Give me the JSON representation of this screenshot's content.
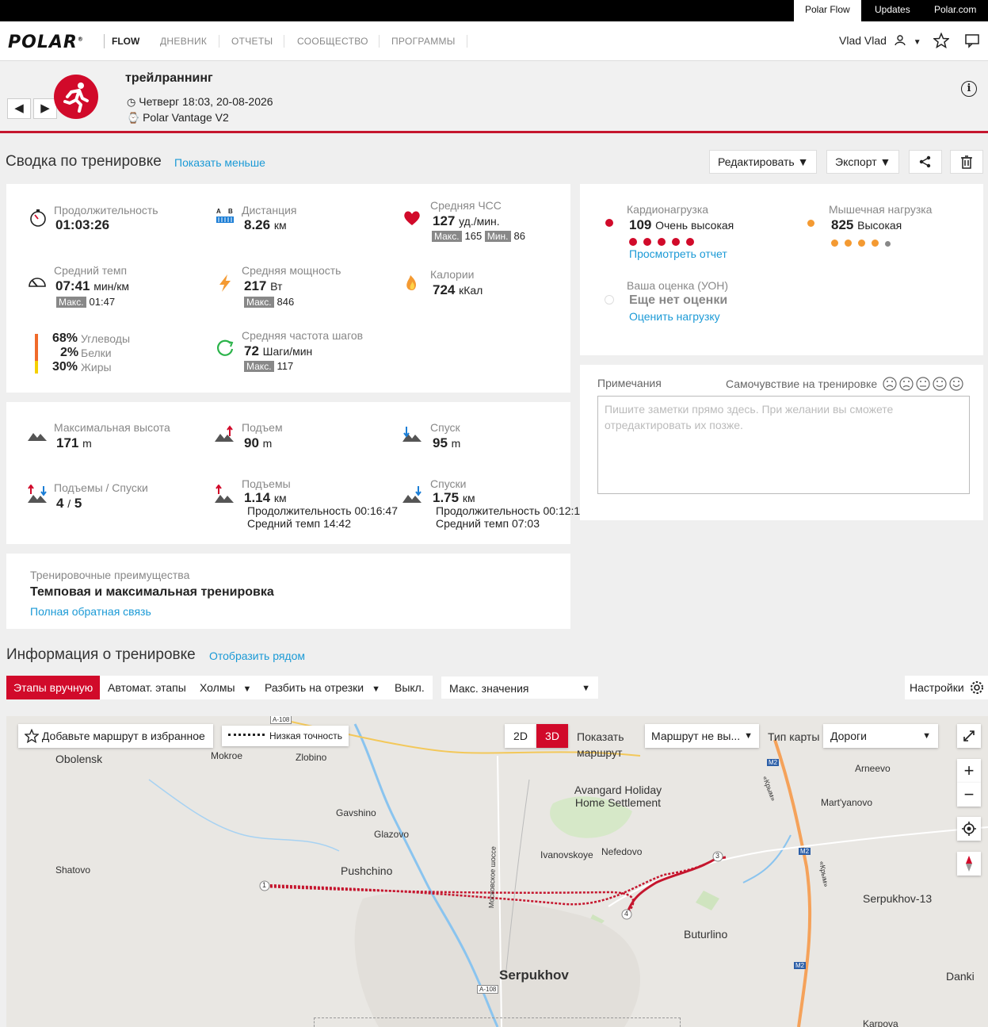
{
  "topbar": {
    "links": [
      "Polar Flow",
      "Updates",
      "Polar.com"
    ]
  },
  "nav": {
    "logo": "POLAR",
    "logo_mark": "®",
    "flow": "FLOW",
    "items": [
      "ДНЕВНИК",
      "ОТЧЕТЫ",
      "СООБЩЕСТВО",
      "ПРОГРАММЫ"
    ],
    "user": "Vlad Vlad"
  },
  "header": {
    "sport": "трейлраннинг",
    "date": "Четверг 18:03, 20-08-2026",
    "device": "Polar Vantage V2",
    "prev": "◀",
    "next": "▶",
    "info": "i"
  },
  "summary": {
    "title": "Сводка по тренировке",
    "toggle": "Показать меньше",
    "buttons": {
      "edit": "Редактировать ▼",
      "export": "Экспорт ▼"
    }
  },
  "metrics": {
    "duration": {
      "label": "Продолжительность",
      "value": "01:03:26"
    },
    "distance": {
      "label": "Дистанция",
      "value": "8.26",
      "unit": "км"
    },
    "hr": {
      "label": "Средняя ЧСС",
      "value": "127",
      "unit": "уд./мин.",
      "max_label": "Макс.",
      "max": "165",
      "min_label": "Мин.",
      "min": "86"
    },
    "pace": {
      "label": "Средний темп",
      "value": "07:41",
      "unit": "мин/км",
      "max_label": "Макс.",
      "max": "01:47"
    },
    "power": {
      "label": "Средняя мощность",
      "value": "217",
      "unit": "Вт",
      "max_label": "Макс.",
      "max": "846"
    },
    "calories": {
      "label": "Калории",
      "value": "724",
      "unit": "кКал"
    },
    "fuel": [
      {
        "pct": "68%",
        "label": "Углеводы"
      },
      {
        "pct": "2%",
        "label": "Белки"
      },
      {
        "pct": "30%",
        "label": "Жиры"
      }
    ],
    "cadence": {
      "label": "Средняя частота шагов",
      "value": "72",
      "unit": "Шаги/мин",
      "max_label": "Макс.",
      "max": "117"
    }
  },
  "elevation": {
    "max_alt": {
      "label": "Максимальная высота",
      "value": "171",
      "unit": "m"
    },
    "ascent": {
      "label": "Подъем",
      "value": "90",
      "unit": "m"
    },
    "descent": {
      "label": "Спуск",
      "value": "95",
      "unit": "m"
    },
    "climbs": {
      "label": "Подъемы / Спуски",
      "value": "4",
      "sep": "/",
      "value2": "5"
    },
    "uphills": {
      "label": "Подъемы",
      "value": "1.14",
      "unit": "км",
      "duration": "Продолжительность 00:16:47",
      "pace": "Средний темп 14:42"
    },
    "downhills": {
      "label": "Спуски",
      "value": "1.75",
      "unit": "км",
      "duration": "Продолжительность 00:12:1",
      "pace": "Средний темп 07:03"
    }
  },
  "benefit": {
    "label": "Тренировочные преимущества",
    "value": "Темповая и максимальная тренировка",
    "link": "Полная обратная связь"
  },
  "load": {
    "cardio": {
      "label": "Кардионагрузка",
      "value": "109",
      "text": "Очень высокая",
      "dots_filled": 5,
      "dots_total": 5,
      "link": "Просмотреть отчет"
    },
    "muscle": {
      "label": "Мышечная нагрузка",
      "value": "825",
      "text": "Высокая",
      "dots_filled": 4,
      "dots_total": 5
    },
    "rpe": {
      "label": "Ваша оценка (УОН)",
      "value": "Еще нет оценки",
      "link": "Оценить нагрузку"
    }
  },
  "notes": {
    "label": "Примечания",
    "feeling_label": "Самочувствие на тренировке",
    "placeholder": "Пишите заметки прямо здесь. При желании вы сможете отредактировать их позже."
  },
  "info_section": {
    "title": "Информация о тренировке",
    "toggle": "Отобразить рядом",
    "laps": {
      "manual": "Этапы вручную",
      "auto": "Автомат. этапы",
      "hills": "Холмы",
      "split": "Разбить на отрезки",
      "off": "Выкл."
    },
    "select": "Макс. значения",
    "settings": "Настройки"
  },
  "map": {
    "favorite": "Добавьте маршрут в избранное",
    "accuracy": "Низкая точность",
    "mode_2d": "2D",
    "mode_3d": "3D",
    "show_route": "Показать маршрут",
    "route_select": "Маршрут не вы...",
    "map_type_label": "Тип карты",
    "map_type": "Дороги",
    "zoom_in": "+",
    "zoom_out": "−",
    "places": {
      "obolensk": "Obolensk",
      "mokroe": "Mokroe",
      "zlobino": "Zlobino",
      "gavshino": "Gavshino",
      "glazovo": "Glazovo",
      "pushchino": "Pushchino",
      "shatovo": "Shatovo",
      "avangard": "Avangard Holiday Home Settlement",
      "ivanovskoye": "Ivanovskoye",
      "nefedovo": "Nefedovo",
      "arneevo": "Arneevo",
      "martyanovo": "Mart'yanovo",
      "serpukhov13": "Serpukhov-13",
      "buturlino": "Buturlino",
      "serpukhov": "Serpukhov",
      "danki": "Danki",
      "karpova": "Karpova",
      "road_shosse": "Московское шоссе",
      "krym": "«Крым»"
    },
    "road_a108": "A-108",
    "road_m2": "M2",
    "markers": [
      "1",
      "3",
      "4"
    ]
  }
}
